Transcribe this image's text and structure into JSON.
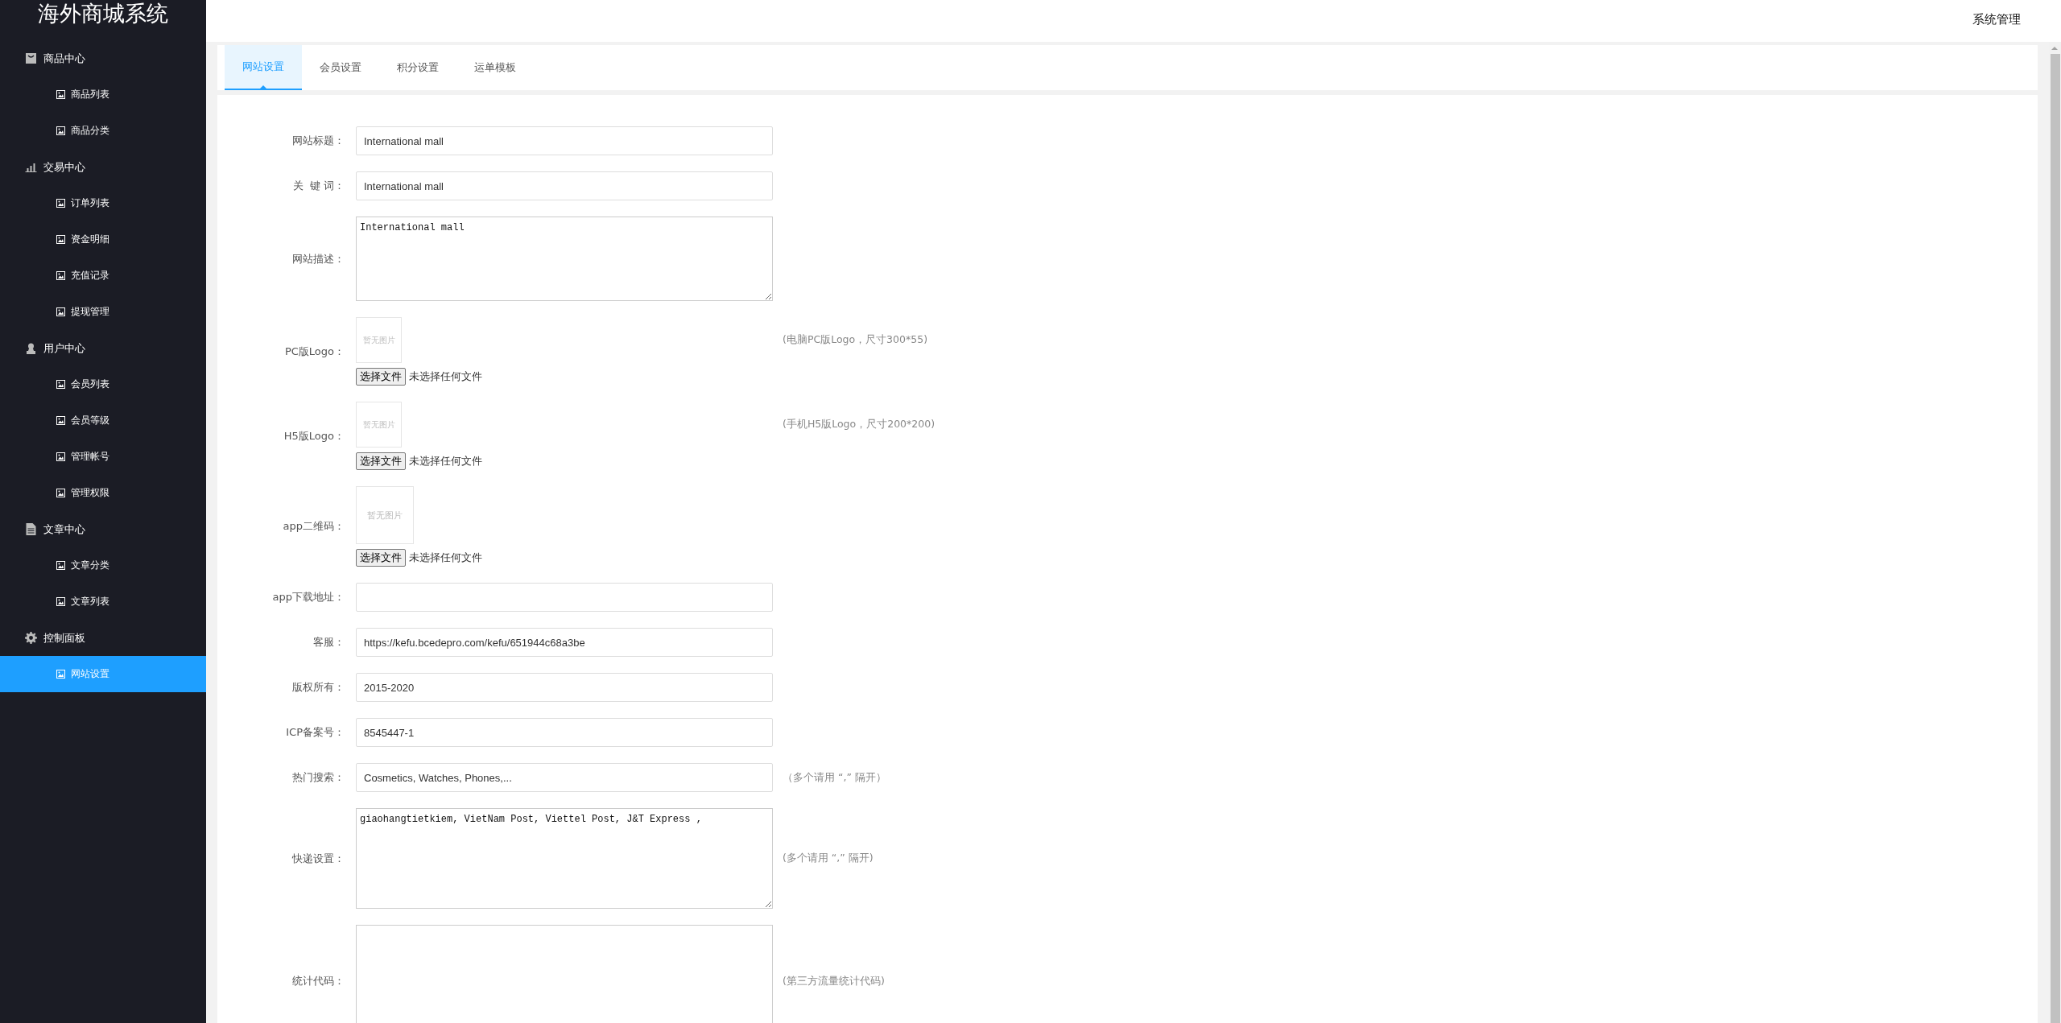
{
  "app_title": "海外商城系统",
  "header": {
    "user_menu": "系统管理"
  },
  "sidebar": {
    "groups": [
      {
        "label": "商品中心",
        "children": [
          {
            "label": "商品列表",
            "selected": false
          },
          {
            "label": "商品分类",
            "selected": false
          }
        ]
      },
      {
        "label": "交易中心",
        "children": [
          {
            "label": "订单列表",
            "selected": false
          },
          {
            "label": "资金明细",
            "selected": false
          },
          {
            "label": "充值记录",
            "selected": false
          },
          {
            "label": "提现管理",
            "selected": false
          }
        ]
      },
      {
        "label": "用户中心",
        "children": [
          {
            "label": "会员列表",
            "selected": false
          },
          {
            "label": "会员等级",
            "selected": false
          },
          {
            "label": "管理帐号",
            "selected": false
          },
          {
            "label": "管理权限",
            "selected": false
          }
        ]
      },
      {
        "label": "文章中心",
        "children": [
          {
            "label": "文章分类",
            "selected": false
          },
          {
            "label": "文章列表",
            "selected": false
          }
        ]
      },
      {
        "label": "控制面板",
        "children": [
          {
            "label": "网站设置",
            "selected": true
          }
        ]
      }
    ]
  },
  "tabs": [
    {
      "label": "网站设置",
      "selected": true
    },
    {
      "label": "会员设置",
      "selected": false
    },
    {
      "label": "积分设置",
      "selected": false
    },
    {
      "label": "运单模板",
      "selected": false
    }
  ],
  "form": {
    "fields": [
      {
        "kind": "input",
        "label": "网站标题：",
        "value": "International mall"
      },
      {
        "kind": "input",
        "label": "关  键 词：",
        "value": "International mall"
      },
      {
        "kind": "textarea",
        "label": "网站描述：",
        "value": "International mall"
      },
      {
        "kind": "image",
        "label": "PC版Logo：",
        "image_text": "暂无图片",
        "button_label": "选择文件",
        "file_status": "未选择任何文件",
        "hint": "(电脑PC版Logo，尺寸300*55)"
      },
      {
        "kind": "image",
        "label": "H5版Logo：",
        "image_text": "暂无图片",
        "button_label": "选择文件",
        "file_status": "未选择任何文件",
        "hint": "(手机H5版Logo，尺寸200*200)"
      },
      {
        "kind": "qr",
        "label": "app二维码：",
        "image_text": "暂无图片",
        "button_label": "选择文件",
        "file_status": "未选择任何文件"
      },
      {
        "kind": "input",
        "label": "app下载地址："
      },
      {
        "kind": "input",
        "label": "客服：",
        "value": "https://kefu.bcedepro.com/kefu/651944c68a3be"
      },
      {
        "kind": "input",
        "label": "版权所有：",
        "value": "2015-2020"
      },
      {
        "kind": "input",
        "label": "ICP备案号：",
        "value": "8545447-1"
      },
      {
        "kind": "input",
        "label": "热门搜索：",
        "value": "Cosmetics, Watches, Phones,...",
        "hint": "（多个请用 “,” 隔开）"
      },
      {
        "kind": "textarea",
        "label": "快递设置：",
        "value": "giaohangtietkiem, VietNam Post, Viettel Post, J&T Express ,",
        "hint": "(多个请用 “,” 隔开)"
      },
      {
        "kind": "tallarea",
        "label": "统计代码：",
        "hint": "(第三方流量统计代码)"
      }
    ]
  }
}
